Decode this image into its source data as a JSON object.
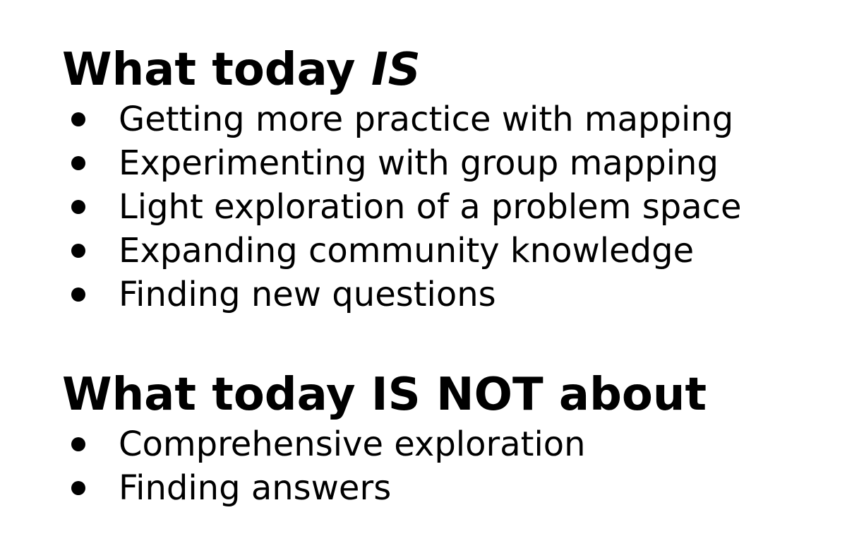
{
  "section_is": {
    "title_prefix": "What today ",
    "title_emphasis": "IS",
    "items": [
      "Getting more practice with mapping",
      "Experimenting with group mapping",
      "Light exploration of a problem space",
      "Expanding community knowledge",
      "Finding new questions"
    ]
  },
  "section_not": {
    "title": "What today IS NOT about",
    "items": [
      "Comprehensive exploration",
      "Finding answers"
    ]
  },
  "colors": {
    "text": "#000000",
    "background": "#ffffff"
  }
}
